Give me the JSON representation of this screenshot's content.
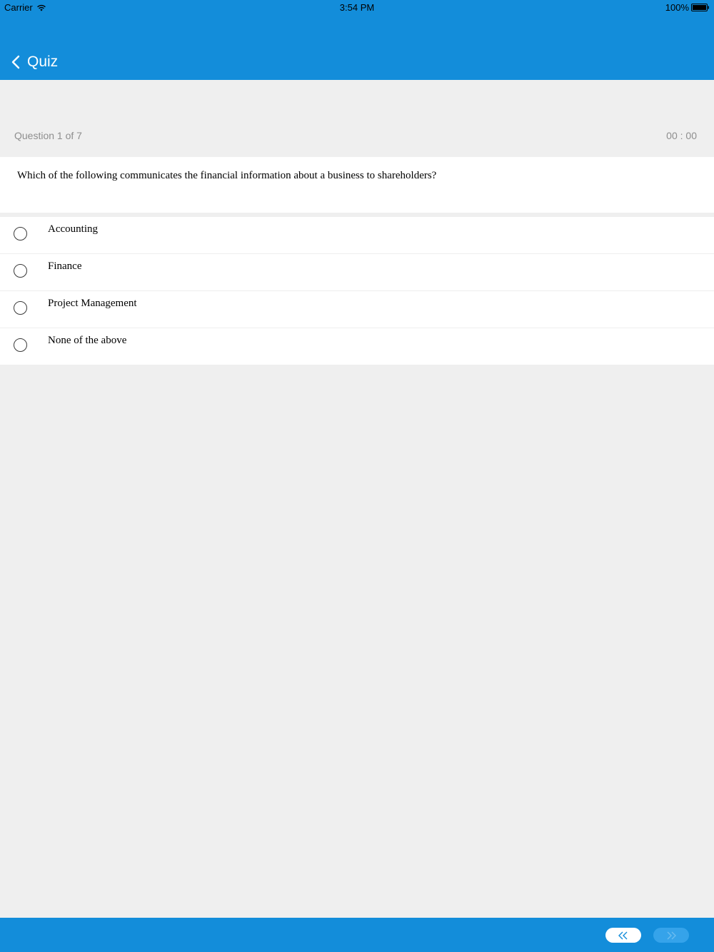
{
  "status_bar": {
    "carrier": "Carrier",
    "time": "3:54 PM",
    "battery": "100%"
  },
  "nav": {
    "title": "Quiz"
  },
  "quiz": {
    "counter": "Question 1 of 7",
    "timer": "00 : 00",
    "question": "Which of the following communicates the financial information about a business to shareholders?",
    "options": [
      {
        "label": "Accounting"
      },
      {
        "label": "Finance"
      },
      {
        "label": "Project Management"
      },
      {
        "label": "None of the above"
      }
    ]
  },
  "icons": {
    "back": "chevron-left-icon",
    "wifi": "wifi-icon",
    "battery": "battery-icon",
    "prev": "double-chevron-left-icon",
    "next": "double-chevron-right-icon"
  },
  "colors": {
    "header": "#138dda",
    "background": "#efefef",
    "next_button_disabled": "#35a3ea"
  }
}
